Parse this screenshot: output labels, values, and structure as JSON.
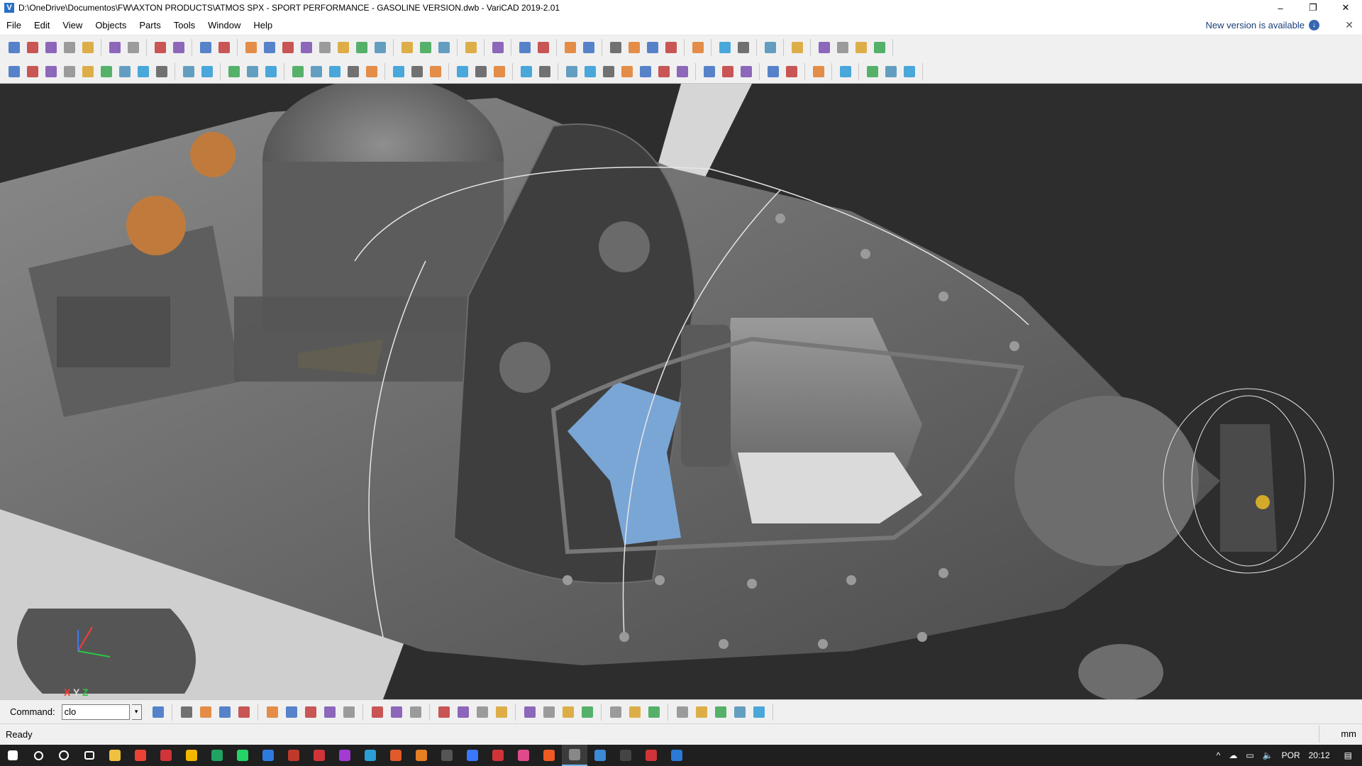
{
  "window": {
    "title": "D:\\OneDrive\\Documentos\\FW\\AXTON PRODUCTS\\ATMOS SPX - SPORT PERFORMANCE - GASOLINE VERSION.dwb - VariCAD 2019-2.01",
    "app_icon": "V",
    "minimize": "–",
    "restore": "❐",
    "close": "✕"
  },
  "menu": {
    "items": [
      "File",
      "Edit",
      "View",
      "Objects",
      "Parts",
      "Tools",
      "Window",
      "Help"
    ],
    "update_note": "New version is available",
    "close_glyph": "✕"
  },
  "command": {
    "label": "Command:",
    "value": "clo",
    "dropdown_glyph": "▾"
  },
  "status": {
    "text": "Ready",
    "units": "mm"
  },
  "axis": {
    "x": "X",
    "y": "Y",
    "z": "Z"
  },
  "taskbar": {
    "language": "POR",
    "time": "20:12"
  },
  "colors": {
    "viewport_bg": "#2d2d2d",
    "accent_blue": "#7aa6d6",
    "accent_gold": "#d4aa2a",
    "accent_copper": "#c07b3c"
  }
}
